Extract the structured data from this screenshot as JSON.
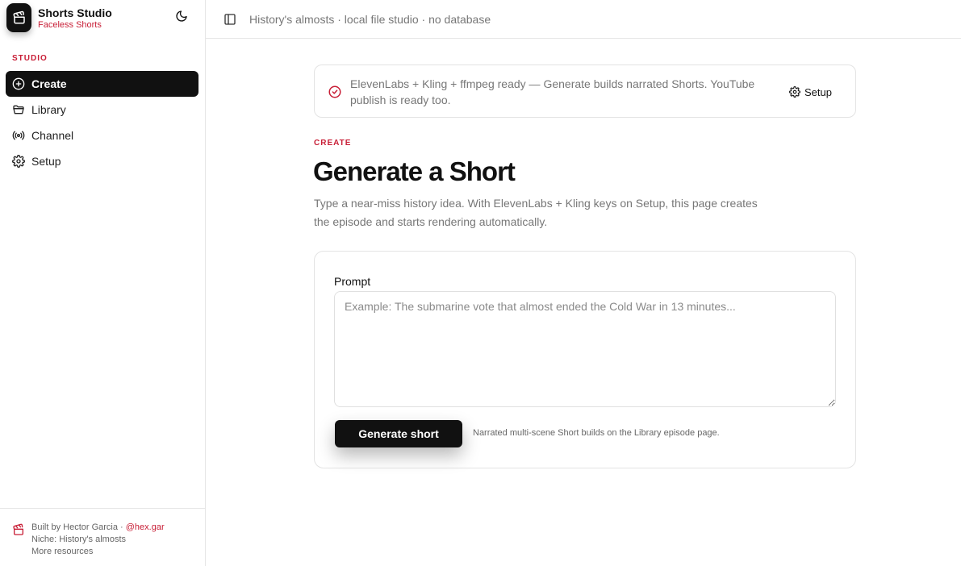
{
  "brand": {
    "title": "Shorts Studio",
    "subtitle": "Faceless Shorts",
    "logo_icon": "clapperboard-icon"
  },
  "sidebar": {
    "section_label": "STUDIO",
    "items": [
      {
        "label": "Create",
        "icon": "plus-circle-icon",
        "active": true
      },
      {
        "label": "Library",
        "icon": "folder-icon",
        "active": false
      },
      {
        "label": "Channel",
        "icon": "broadcast-icon",
        "active": false
      },
      {
        "label": "Setup",
        "icon": "gear-icon",
        "active": false
      }
    ],
    "footer": {
      "built_by": "Built by Hector Garcia · ",
      "handle": "@hex.gar",
      "niche": "Niche: History's almosts",
      "more": "More resources"
    }
  },
  "topbar": {
    "text": "History's almosts · local file studio · no database"
  },
  "banner": {
    "text": "ElevenLabs + Kling + ffmpeg ready — Generate builds narrated Shorts. YouTube publish is ready too.",
    "setup_label": "Setup"
  },
  "main": {
    "eyebrow": "CREATE",
    "title": "Generate a Short",
    "description": "Type a near-miss history idea. With ElevenLabs + Kling keys on Setup, this page creates the episode and starts rendering automatically.",
    "prompt_label": "Prompt",
    "prompt_placeholder": "Example: The submarine vote that almost ended the Cold War in 13 minutes...",
    "prompt_value": "",
    "generate_label": "Generate short",
    "generate_hint": "Narrated multi-scene Short builds on the Library episode page."
  },
  "colors": {
    "accent": "#c81e36",
    "dark": "#111111",
    "muted": "#777777",
    "border": "#e3e3e3"
  }
}
